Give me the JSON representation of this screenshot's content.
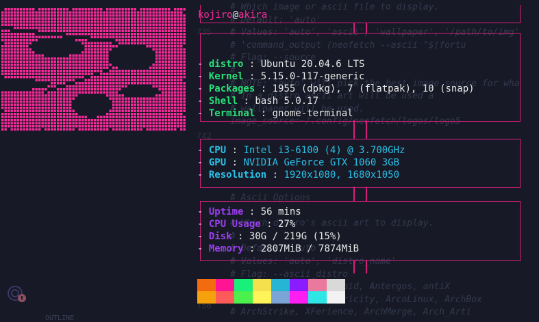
{
  "header": {
    "user": "kojiro",
    "at": "@",
    "host": "akira"
  },
  "groups": [
    {
      "key_color": "green",
      "value_color": "white",
      "items": [
        {
          "key": "distro",
          "value": "Ubuntu 20.04.6 LTS"
        },
        {
          "key": "Kernel",
          "value": "5.15.0-117-generic"
        },
        {
          "key": "Packages",
          "value": "1955 (dpkg), 7 (flatpak), 10 (snap)"
        },
        {
          "key": "Shell",
          "value": "bash 5.0.17"
        },
        {
          "key": "Terminal",
          "value": "gnome-terminal"
        }
      ]
    },
    {
      "key_color": "cyan",
      "value_color": "cyan",
      "items": [
        {
          "key": "CPU",
          "value": "Intel i3-6100 (4) @ 3.700GHz"
        },
        {
          "key": "GPU",
          "value": "NVIDIA GeForce GTX 1060 3GB"
        },
        {
          "key": "Resolution",
          "value": "1920x1080, 1680x1050"
        }
      ]
    },
    {
      "key_color": "purple",
      "value_color": "white",
      "items": [
        {
          "key": "Uptime",
          "value": "56 mins"
        },
        {
          "key": "CPU Usage",
          "value": "27%"
        },
        {
          "key": "Disk",
          "value": "30G / 219G (15%)"
        },
        {
          "key": "Memory",
          "value": "2807MiB / 7874MiB"
        }
      ]
    }
  ],
  "separator": " : ",
  "dash": "- ",
  "palette": {
    "row1": [
      "#f26b0f",
      "#ff1493",
      "#19f07a",
      "#f4e04d",
      "#26b5d4",
      "#8a1cff",
      "#e9799d",
      "#d9d9d9"
    ],
    "row2": [
      "#f5a10d",
      "#ff5a5a",
      "#4cf04c",
      "#fff35a",
      "#7aa5d6",
      "#ff1ef2",
      "#2ee6e6",
      "#f2f2f2"
    ]
  },
  "colors": {
    "accent": "#ff2a9d",
    "frame": "#d61f7d",
    "green": "#28e07a",
    "cyan": "#2bc0e8",
    "purple": "#9b3ef0",
    "background": "#171a26"
  },
  "background_editor": {
    "lines": [
      "# Which image or ascii file to display.",
      "# Default:  'auto'",
      "# Values:   'auto', 'ascii', 'wallpaper', '/path/to/img'",
      "#           'command_output (neofetch --ascii \"$(fortu",
      "# Flag:     --source",
      "#",
      "# NOTE: 'auto' will pick the best image source for wha",
      "#       In a distro ascii art will be used a",
      "#       wallpaper will be used.",
      "image_source=~/.config/neofetch/logos/logo5",
      "",
      "",
      "",
      "",
      "",
      "# Ascii Options",
      "",
      "# Which distro's ascii art to display.",
      "#",
      "# Default: 'auto'",
      "# Values:  'auto', 'distro_name'",
      "# Flag:    --ascii_distro",
      "# NOTE: Anarchy, Android, Antergos, antiX",
      "#       'AOSC OS/Retro', Apricity, ArcoLinux, ArchBox",
      "#       ArchStrike, XFerience, ArchMerge, Arch_Arti"
    ],
    "line_numbers": [
      "735",
      "742",
      "755",
      "756"
    ],
    "outline_label": "OUTLINE"
  }
}
